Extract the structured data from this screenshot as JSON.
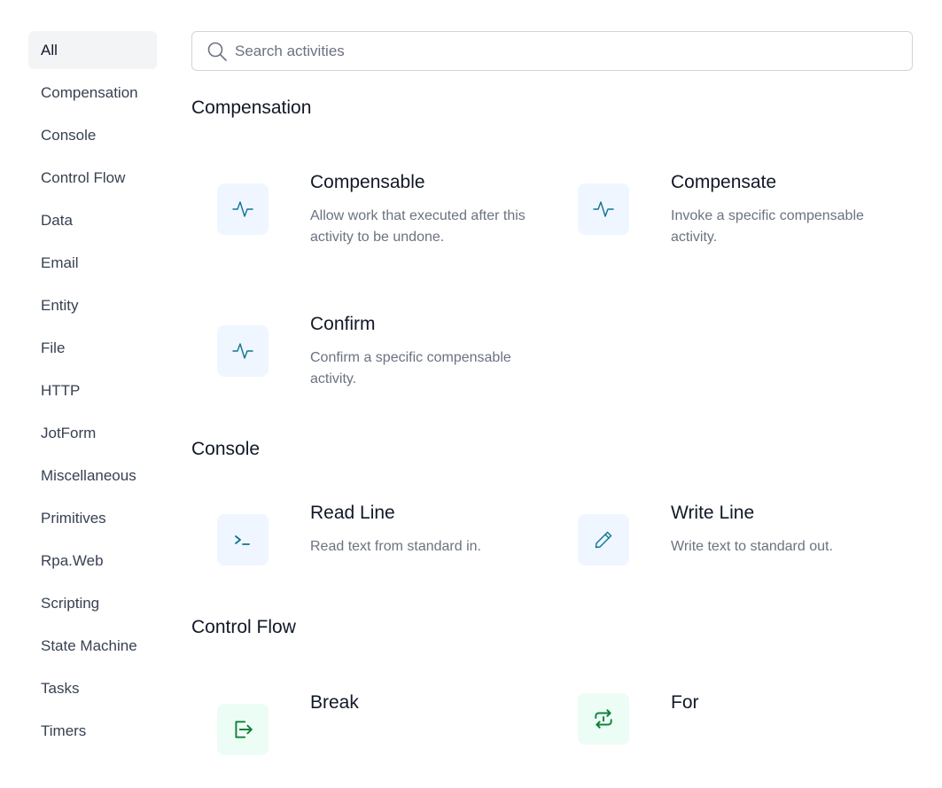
{
  "sidebar": {
    "items": [
      {
        "label": "All"
      },
      {
        "label": "Compensation"
      },
      {
        "label": "Console"
      },
      {
        "label": "Control Flow"
      },
      {
        "label": "Data"
      },
      {
        "label": "Email"
      },
      {
        "label": "Entity"
      },
      {
        "label": "File"
      },
      {
        "label": "HTTP"
      },
      {
        "label": "JotForm"
      },
      {
        "label": "Miscellaneous"
      },
      {
        "label": "Primitives"
      },
      {
        "label": "Rpa.Web"
      },
      {
        "label": "Scripting"
      },
      {
        "label": "State Machine"
      },
      {
        "label": "Tasks"
      },
      {
        "label": "Timers"
      }
    ]
  },
  "search": {
    "placeholder": "Search activities",
    "value": ""
  },
  "sections": {
    "compensation": {
      "heading": "Compensation",
      "cards": [
        {
          "title": "Compensable",
          "description": "Allow work that executed after this activity to be undone.",
          "icon": "activity-pulse-icon"
        },
        {
          "title": "Compensate",
          "description": "Invoke a specific compensable activity.",
          "icon": "activity-pulse-icon"
        },
        {
          "title": "Confirm",
          "description": "Confirm a specific compensable activity.",
          "icon": "activity-pulse-icon"
        }
      ]
    },
    "console": {
      "heading": "Console",
      "cards": [
        {
          "title": "Read Line",
          "description": "Read text from standard in.",
          "icon": "terminal-prompt-icon"
        },
        {
          "title": "Write Line",
          "description": "Write text to standard out.",
          "icon": "pencil-icon"
        }
      ]
    },
    "control_flow": {
      "heading": "Control Flow",
      "cards": [
        {
          "title": "Break",
          "description": "",
          "icon": "exit-arrow-icon"
        },
        {
          "title": "For",
          "description": "",
          "icon": "repeat-loop-icon"
        }
      ]
    }
  },
  "colors": {
    "accent_blue": "#0e7490",
    "accent_green": "#15803d",
    "tile_blue_bg": "#eff6ff",
    "tile_green_bg": "#ecfdf5",
    "active_bg": "#f3f4f6"
  }
}
